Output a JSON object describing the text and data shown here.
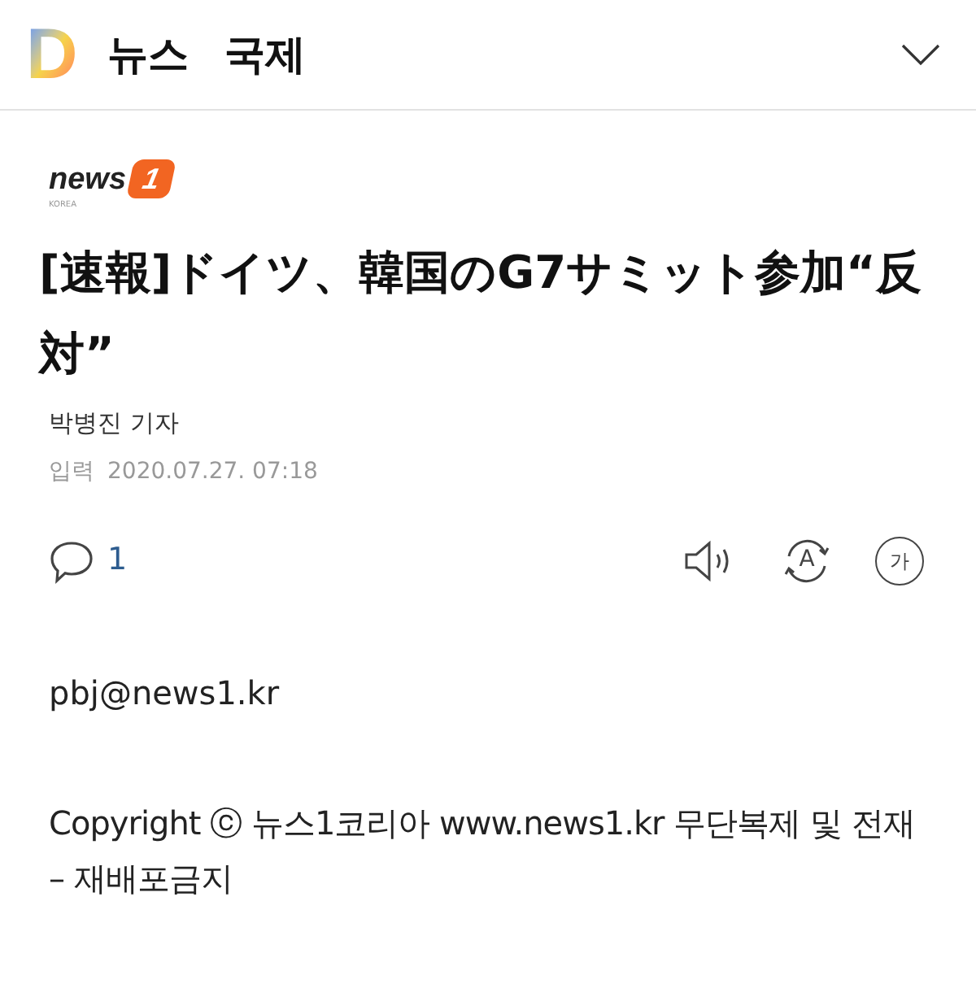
{
  "header": {
    "logo": "D",
    "section": "뉴스",
    "category": "국제"
  },
  "source_logo": {
    "word": "news",
    "digit": "1",
    "sub": "KOREA"
  },
  "headline": "[速報]ドイツ、韓国のG7サミット参加“反対”",
  "byline": "박병진 기자",
  "published": {
    "label": "입력",
    "time": "2020.07.27. 07:18"
  },
  "toolbar": {
    "comment_count": "1",
    "translate_letter": "A",
    "font_letter": "가"
  },
  "body": [
    "pbj@news1.kr",
    "Copyright ⓒ 뉴스1코리아 www.news1.kr 무단복제 및 전재 – 재배포금지"
  ]
}
